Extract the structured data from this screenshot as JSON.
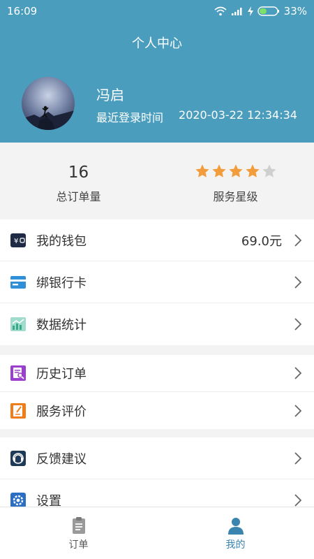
{
  "status_bar": {
    "time": "16:09",
    "battery": "33%"
  },
  "header": {
    "title": "个人中心",
    "user_name": "冯启",
    "last_login_label": "最近登录时间",
    "last_login_time": "2020-03-22 12:34:34"
  },
  "stats": {
    "order_count": "16",
    "order_count_label": "总订单量",
    "rating": 4,
    "rating_max": 5,
    "rating_label": "服务星级"
  },
  "menu": {
    "wallet": {
      "label": "我的钱包",
      "value": "69.0元"
    },
    "bank_card": {
      "label": "绑银行卡"
    },
    "statistics": {
      "label": "数据统计"
    },
    "order_history": {
      "label": "历史订单"
    },
    "service_review": {
      "label": "服务评价"
    },
    "feedback": {
      "label": "反馈建议"
    },
    "settings": {
      "label": "设置"
    }
  },
  "tabbar": {
    "orders": {
      "label": "订单"
    },
    "mine": {
      "label": "我的"
    }
  },
  "colors": {
    "header_bg": "#4a9dbd",
    "star_on": "#f39c3b",
    "star_off": "#cfcfcf",
    "tab_active": "#3a84b0",
    "tab_inactive": "#555555"
  }
}
